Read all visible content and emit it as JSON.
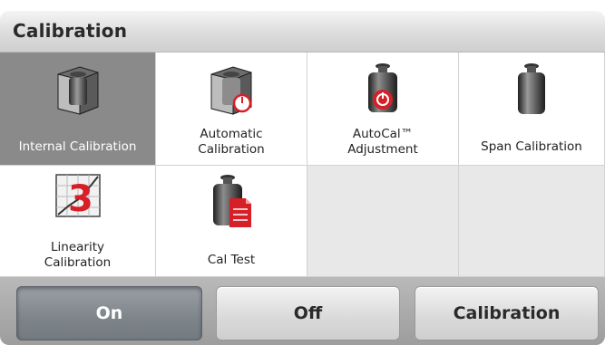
{
  "header": {
    "title": "Calibration"
  },
  "tiles": [
    {
      "label": "Internal Calibration",
      "icon": "internal-calibration-icon",
      "selected": true
    },
    {
      "label": "Automatic\nCalibration",
      "icon": "automatic-calibration-icon"
    },
    {
      "label": "AutoCal™\nAdjustment",
      "icon": "autocal-adjustment-icon"
    },
    {
      "label": "Span Calibration",
      "icon": "span-calibration-icon"
    },
    {
      "label": "Linearity\nCalibration",
      "icon": "linearity-calibration-icon"
    },
    {
      "label": "Cal Test",
      "icon": "cal-test-icon"
    }
  ],
  "footer": {
    "on_label": "On",
    "off_label": "Off",
    "calibration_label": "Calibration"
  },
  "colors": {
    "selected_tile": "#8a8a8a",
    "empty_tile": "#e8e8e8",
    "weight_dark": "#3a3a3a",
    "accent_red": "#d61f26"
  }
}
